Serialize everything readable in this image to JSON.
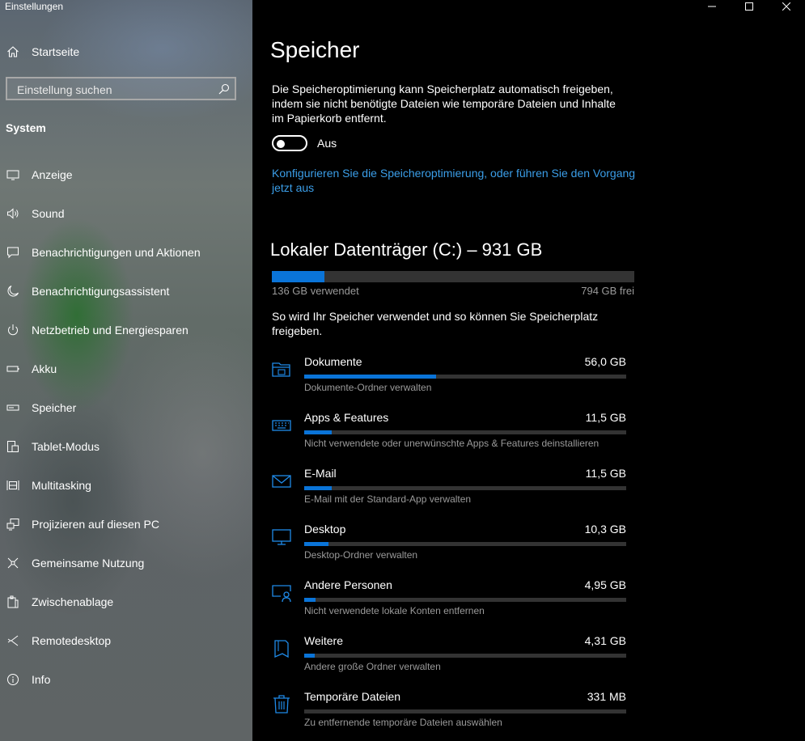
{
  "app": {
    "title": "Einstellungen"
  },
  "sidebar": {
    "home_label": "Startseite",
    "search_placeholder": "Einstellung suchen",
    "section_heading": "System",
    "items": [
      {
        "label": "Anzeige",
        "icon": "display-icon"
      },
      {
        "label": "Sound",
        "icon": "speaker-icon"
      },
      {
        "label": "Benachrichtigungen und Aktionen",
        "icon": "notification-icon"
      },
      {
        "label": "Benachrichtigungsassistent",
        "icon": "moon-icon"
      },
      {
        "label": "Netzbetrieb und Energiesparen",
        "icon": "power-icon"
      },
      {
        "label": "Akku",
        "icon": "battery-icon"
      },
      {
        "label": "Speicher",
        "icon": "storage-icon"
      },
      {
        "label": "Tablet-Modus",
        "icon": "tablet-icon"
      },
      {
        "label": "Multitasking",
        "icon": "multitasking-icon"
      },
      {
        "label": "Projizieren auf diesen PC",
        "icon": "project-icon"
      },
      {
        "label": "Gemeinsame Nutzung",
        "icon": "share-icon"
      },
      {
        "label": "Zwischenablage",
        "icon": "clipboard-icon"
      },
      {
        "label": "Remotedesktop",
        "icon": "remote-desktop-icon"
      },
      {
        "label": "Info",
        "icon": "info-icon"
      }
    ]
  },
  "main": {
    "title": "Speicher",
    "storage_sense_description": "Die Speicheroptimierung kann Speicherplatz automatisch freigeben, indem sie nicht benötigte Dateien wie temporäre Dateien und Inhalte im Papierkorb entfernt.",
    "toggle_state": "Aus",
    "toggle_on": false,
    "configure_link": "Konfigurieren Sie die Speicheroptimierung, oder führen Sie den Vorgang jetzt aus",
    "drive": {
      "title": "Lokaler Datenträger (C:) – 931 GB",
      "used_label": "136 GB verwendet",
      "free_label": "794 GB frei",
      "used_fraction": 0.146
    },
    "usage_description": "So wird Ihr Speicher verwendet und so können Sie Speicherplatz freigeben.",
    "categories": [
      {
        "name": "Dokumente",
        "size": "56,0 GB",
        "description": "Dokumente-Ordner verwalten",
        "fraction": 0.41,
        "icon": "folder-icon"
      },
      {
        "name": "Apps & Features",
        "size": "11,5 GB",
        "description": "Nicht verwendete oder unerwünschte Apps & Features deinstallieren",
        "fraction": 0.085,
        "icon": "keyboard-icon"
      },
      {
        "name": "E-Mail",
        "size": "11,5 GB",
        "description": "E-Mail mit der Standard-App verwalten",
        "fraction": 0.085,
        "icon": "mail-icon"
      },
      {
        "name": "Desktop",
        "size": "10,3 GB",
        "description": "Desktop-Ordner verwalten",
        "fraction": 0.075,
        "icon": "monitor-icon"
      },
      {
        "name": "Andere Personen",
        "size": "4,95 GB",
        "description": "Nicht verwendete lokale Konten entfernen",
        "fraction": 0.036,
        "icon": "user-account-icon"
      },
      {
        "name": "Weitere",
        "size": "4,31 GB",
        "description": "Andere große Ordner verwalten",
        "fraction": 0.032,
        "icon": "file-icon"
      },
      {
        "name": "Temporäre Dateien",
        "size": "331 MB",
        "description": "Zu entfernende temporäre Dateien auswählen",
        "fraction": 0.0,
        "icon": "trash-icon"
      }
    ]
  },
  "colors": {
    "accent": "#0a74d8",
    "link": "#3b9ee8",
    "bar_track": "#333333",
    "secondary_text": "#9a9a9a"
  }
}
